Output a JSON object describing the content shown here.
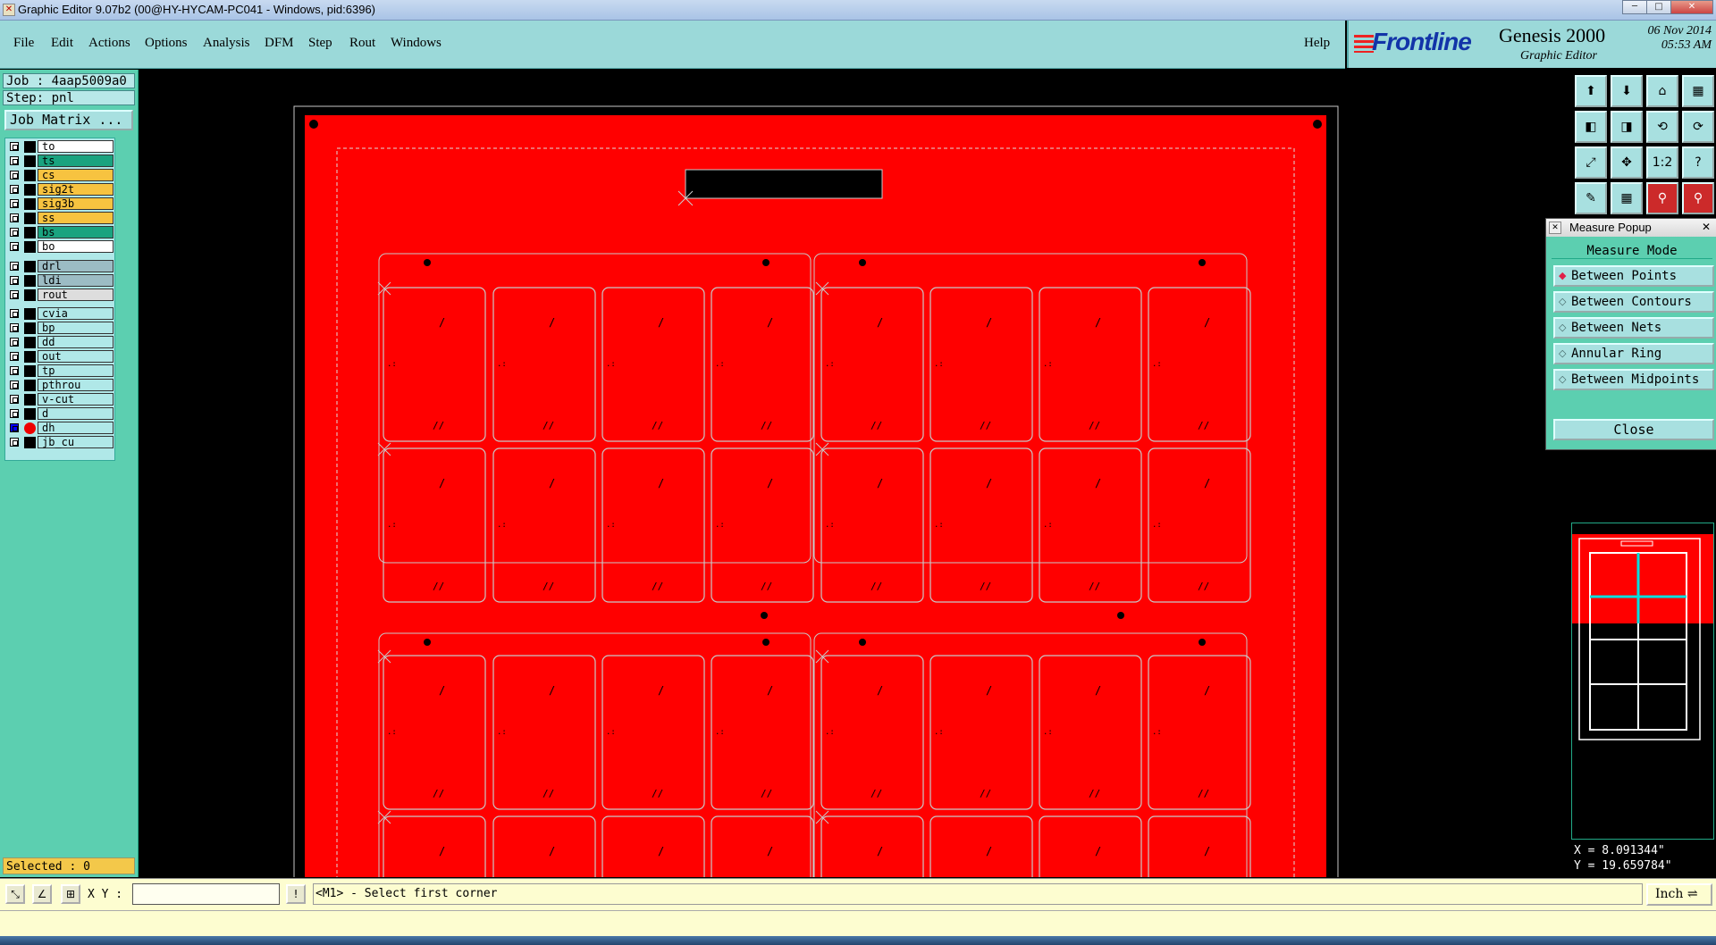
{
  "window": {
    "title": "Graphic Editor 9.07b2 (00@HY-HYCAM-PC041 - Windows, pid:6396)",
    "icon_glyph": "✕",
    "controls": [
      "─",
      "□",
      "✕"
    ]
  },
  "menu": {
    "items": [
      "File",
      "Edit",
      "Actions",
      "Options",
      "Analysis",
      "DFM",
      "Step",
      "Rout",
      "Windows"
    ],
    "help": "Help"
  },
  "brand": {
    "logo": "Frontline",
    "product": "Genesis 2000",
    "subtitle": "Graphic Editor",
    "date": "06 Nov 2014",
    "time": "05:53 AM"
  },
  "job": {
    "job_line": "Job : 4aap5009a0",
    "step_line": "Step: pnl",
    "matrix_button": "Job Matrix ..."
  },
  "layers": [
    {
      "name": "to",
      "color": "#ffffff"
    },
    {
      "name": "ts",
      "color": "#1aa37f"
    },
    {
      "name": "cs",
      "color": "#f7c340"
    },
    {
      "name": "sig2t",
      "color": "#f7c340"
    },
    {
      "name": "sig3b",
      "color": "#f7c340"
    },
    {
      "name": "ss",
      "color": "#f7c340"
    },
    {
      "name": "bs",
      "color": "#1aa37f"
    },
    {
      "name": "bo",
      "color": "#ffffff"
    },
    {
      "name": "drl",
      "color": "#9cbcc4"
    },
    {
      "name": "ldi",
      "color": "#9cbcc4"
    },
    {
      "name": "rout",
      "color": "#dddddd"
    },
    {
      "name": "cvia",
      "color": "#b0e8e8"
    },
    {
      "name": "bp",
      "color": "#b0e8e8"
    },
    {
      "name": "dd",
      "color": "#b0e8e8"
    },
    {
      "name": "out",
      "color": "#b0e8e8"
    },
    {
      "name": "tp",
      "color": "#b0e8e8"
    },
    {
      "name": "pthrou",
      "color": "#b0e8e8"
    },
    {
      "name": "v-cut",
      "color": "#b0e8e8"
    },
    {
      "name": "d",
      "color": "#b0e8e8"
    },
    {
      "name": "dh",
      "color": "#b0e8e8",
      "active": true
    },
    {
      "name": "jb_cu",
      "color": "#b0e8e8"
    }
  ],
  "selected": "Selected : 0",
  "measure_popup": {
    "title": "Measure Popup",
    "mode_label": "Measure Mode",
    "options": [
      "Between Points",
      "Between Contours",
      "Between Nets",
      "Annular Ring",
      "Between Midpoints"
    ],
    "selected_index": 0,
    "close": "Close"
  },
  "coords": {
    "x": "X = 8.091344\"",
    "y": "Y = 19.659784\""
  },
  "statusbar": {
    "xy_label": "X Y :",
    "xy_value": "",
    "prompt": "<M1> - Select first corner",
    "unit": "Inch ⇌"
  },
  "colors": {
    "board": "#ff0000",
    "panel_bg": "#5ccfb0",
    "menu_bg": "#9bd9d9",
    "outline": "#c8c8c8"
  },
  "toolbar_icons": [
    "open-icon",
    "save-icon",
    "home-icon",
    "split-icon",
    "left-icon",
    "right-icon",
    "undo-icon",
    "redo-icon",
    "fit-icon",
    "center-icon",
    "scale-icon",
    "help-icon",
    "pen-icon",
    "grid-icon",
    "signal-icon",
    "signal2-icon"
  ],
  "toolbar_glyphs": [
    "⬆",
    "⬇",
    "⌂",
    "▦",
    "◧",
    "◨",
    "⟲",
    "⟳",
    "⤢",
    "✥",
    "1:2",
    "?",
    "✎",
    "▦",
    "⚲",
    "⚲"
  ],
  "status_icons": [
    "zoom-icon",
    "snap-icon",
    "grid-icon",
    "alert-icon"
  ],
  "status_glyphs": [
    "⤡",
    "∠",
    "⊞",
    "!"
  ]
}
